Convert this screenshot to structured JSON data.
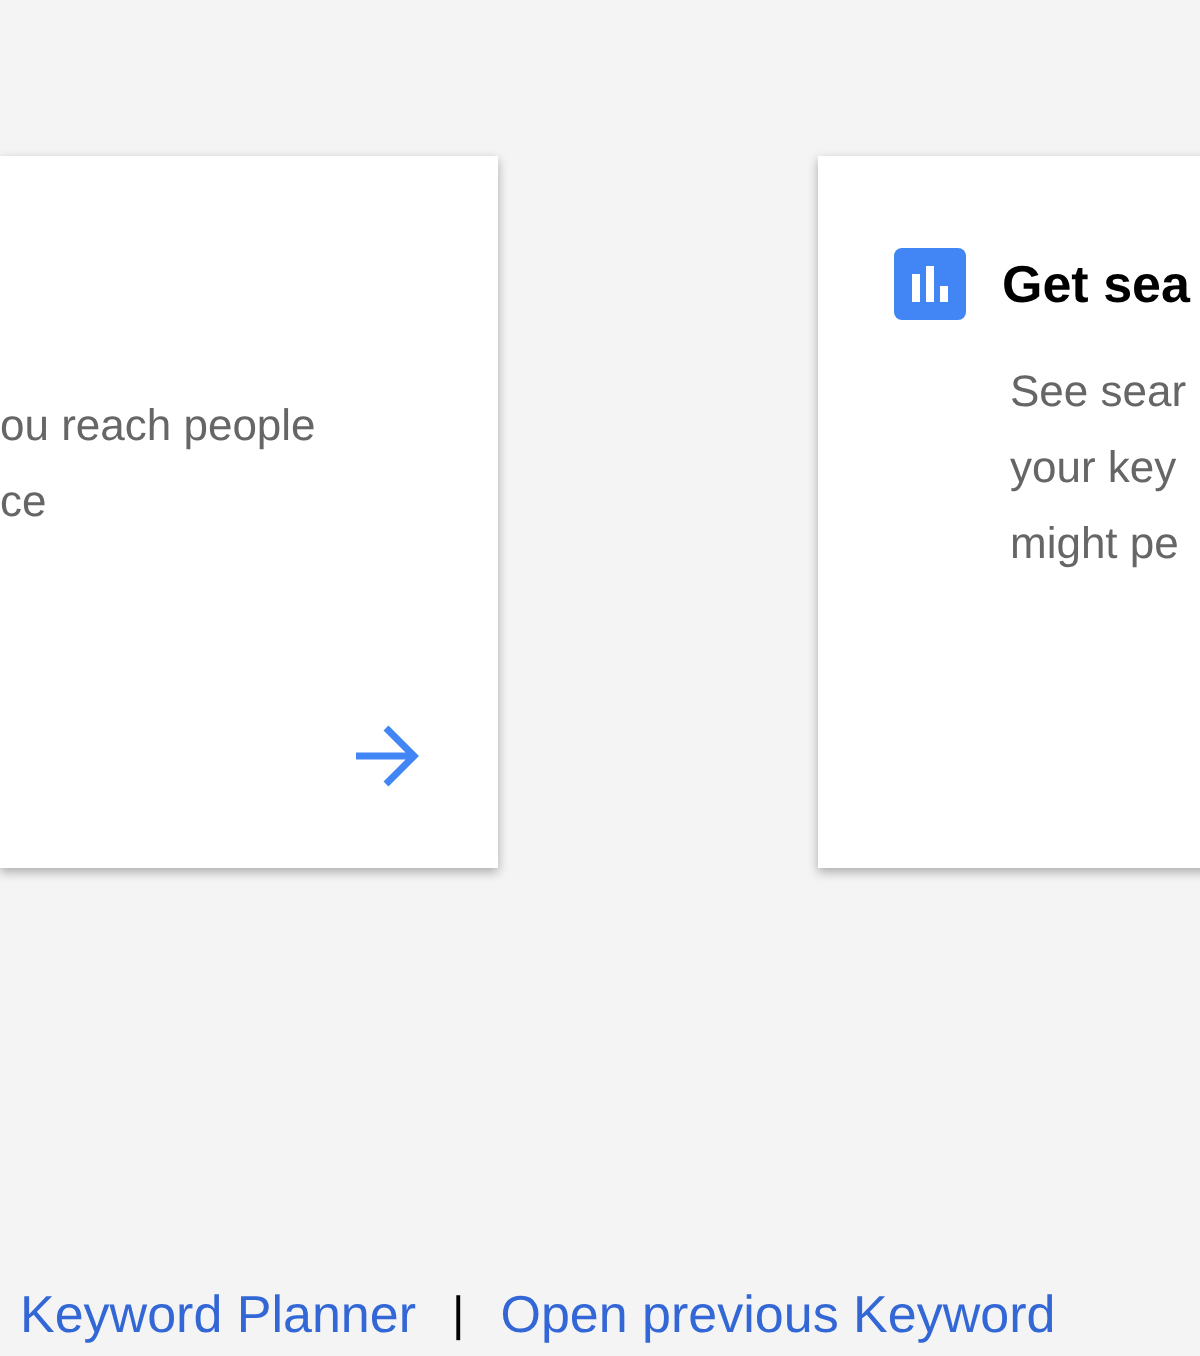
{
  "cards": [
    {
      "body": [
        "ou reach people",
        "ce"
      ],
      "has_arrow": true
    },
    {
      "title": "Get sea",
      "body": [
        "See sear",
        "your key",
        "might pe"
      ],
      "has_arrow": false
    }
  ],
  "footer_links": [
    {
      "label": "Keyword Planner"
    },
    {
      "label": "Open previous Keyword"
    }
  ],
  "footer_separator": "|"
}
